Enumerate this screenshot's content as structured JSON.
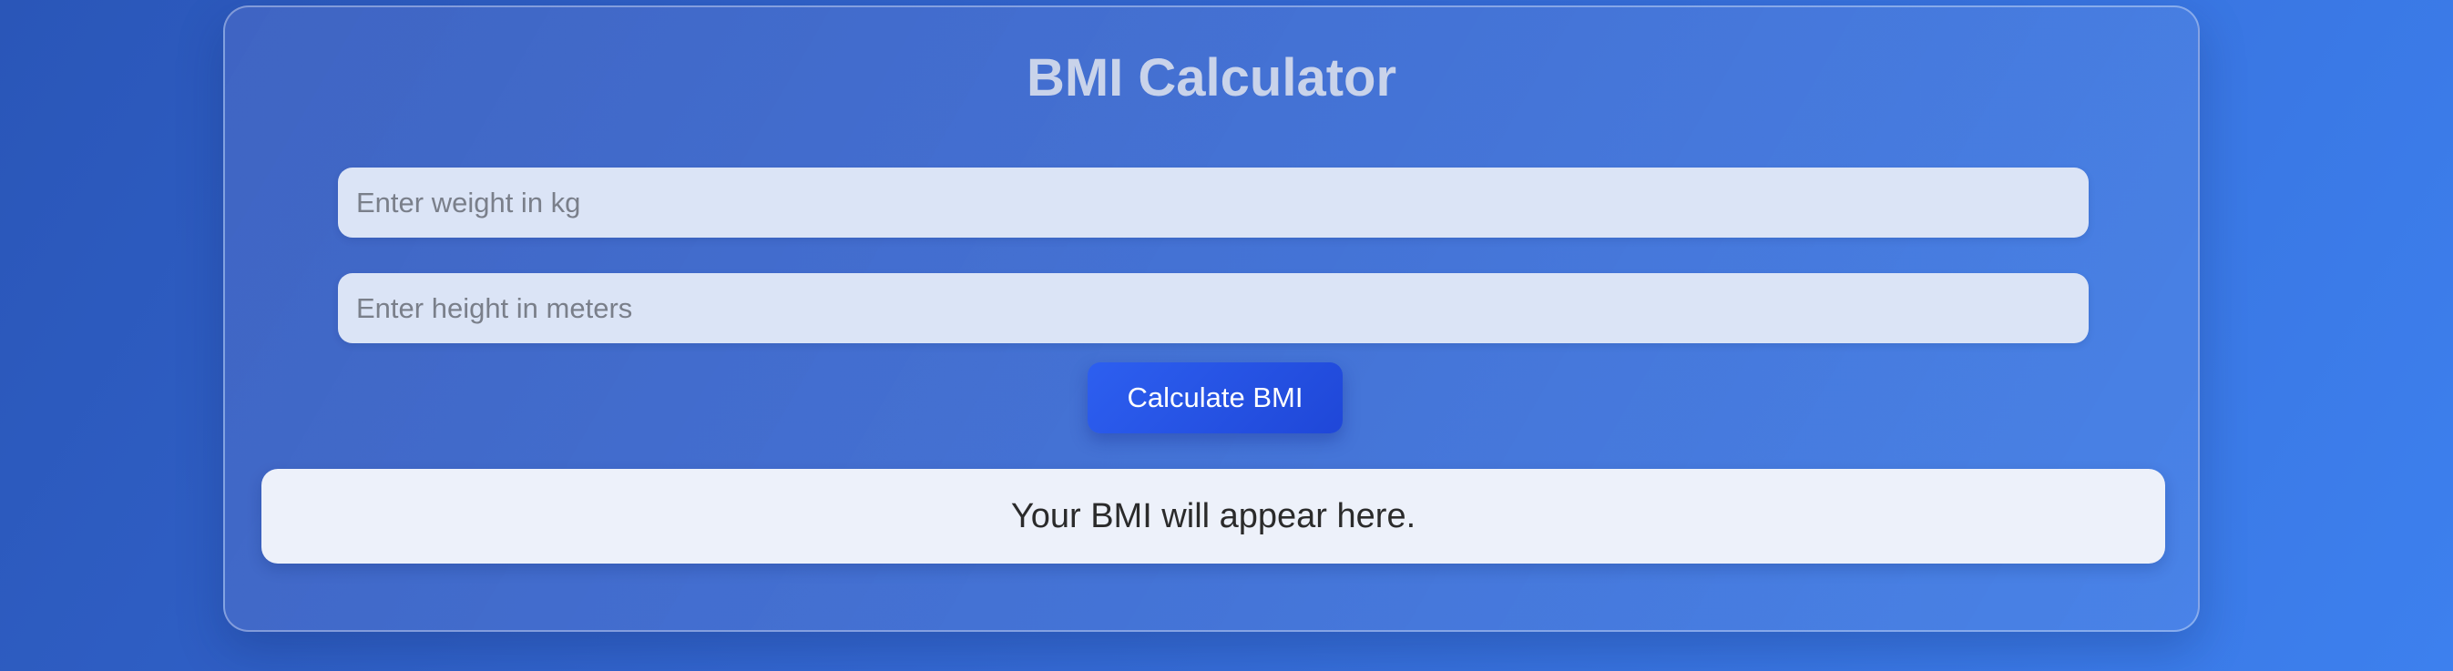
{
  "app": {
    "title": "BMI Calculator"
  },
  "form": {
    "weight_placeholder": "Enter weight in kg",
    "weight_value": "",
    "height_placeholder": "Enter height in meters",
    "height_value": "",
    "submit_label": "Calculate BMI"
  },
  "result": {
    "text": "Your BMI will appear here."
  },
  "colors": {
    "background_start": "#2a56b8",
    "background_end": "#3d80ee",
    "button": "#2d5ff0",
    "input_background": "#dbe4f6",
    "result_background": "#edf1fa",
    "title_text": "#c9d3ea"
  }
}
